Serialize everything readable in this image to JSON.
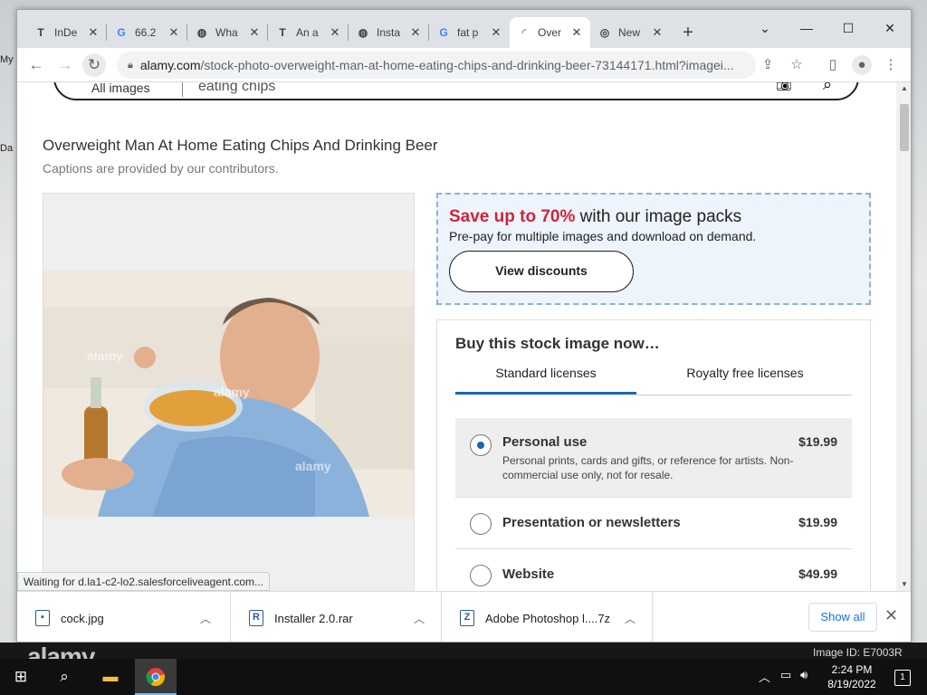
{
  "desktop": {
    "label_top": "My",
    "label_mid": "Da"
  },
  "browser": {
    "tabs": [
      {
        "favicon": "T",
        "title": "InDe"
      },
      {
        "favicon": "G",
        "title": "66.2"
      },
      {
        "favicon": "◍",
        "title": "Wha"
      },
      {
        "favicon": "T",
        "title": "An a"
      },
      {
        "favicon": "◍",
        "title": "Insta"
      },
      {
        "favicon": "G",
        "title": "fat p"
      },
      {
        "favicon": "◜",
        "title": "Over"
      },
      {
        "favicon": "◎",
        "title": "New"
      }
    ],
    "url_host": "alamy.com",
    "url_path": "/stock-photo-overweight-man-at-home-eating-chips-and-drinking-beer-73144171.html?imagei..."
  },
  "page": {
    "search": {
      "filter_label": "All images",
      "query": "eating chips"
    },
    "title": "Overweight Man At Home Eating Chips And Drinking Beer",
    "caption": "Captions are provided by our contributors.",
    "watermark": "alamy",
    "promo": {
      "highlight": "Save up to 70%",
      "rest": " with our image packs",
      "sub": "Pre-pay for multiple images and download on demand.",
      "button": "View discounts"
    },
    "buy": {
      "title": "Buy this stock image now…",
      "tabs": [
        "Standard licenses",
        "Royalty free licenses"
      ],
      "options": [
        {
          "name": "Personal use",
          "price": "$19.99",
          "desc": "Personal prints, cards and gifts, or reference for artists. Non-commercial use only, not for resale.",
          "selected": true
        },
        {
          "name": "Presentation or newsletters",
          "price": "$19.99",
          "desc": "",
          "selected": false
        },
        {
          "name": "Website",
          "price": "$49.99",
          "desc": "",
          "selected": false
        }
      ]
    }
  },
  "status": "Waiting for d.la1-c2-lo2.salesforceliveagent.com...",
  "downloads": {
    "items": [
      {
        "name": "cock.jpg",
        "icon": "image-file-icon"
      },
      {
        "name": "Installer 2.0.rar",
        "icon": "archive-file-icon"
      },
      {
        "name": "Adobe Photoshop l....7z",
        "icon": "archive-file-icon"
      }
    ],
    "show_all": "Show all"
  },
  "overlay": {
    "logo": "alamy",
    "image_id": "Image ID: E7003R"
  },
  "taskbar": {
    "time": "2:24 PM",
    "date": "8/19/2022",
    "notifications": "1"
  }
}
